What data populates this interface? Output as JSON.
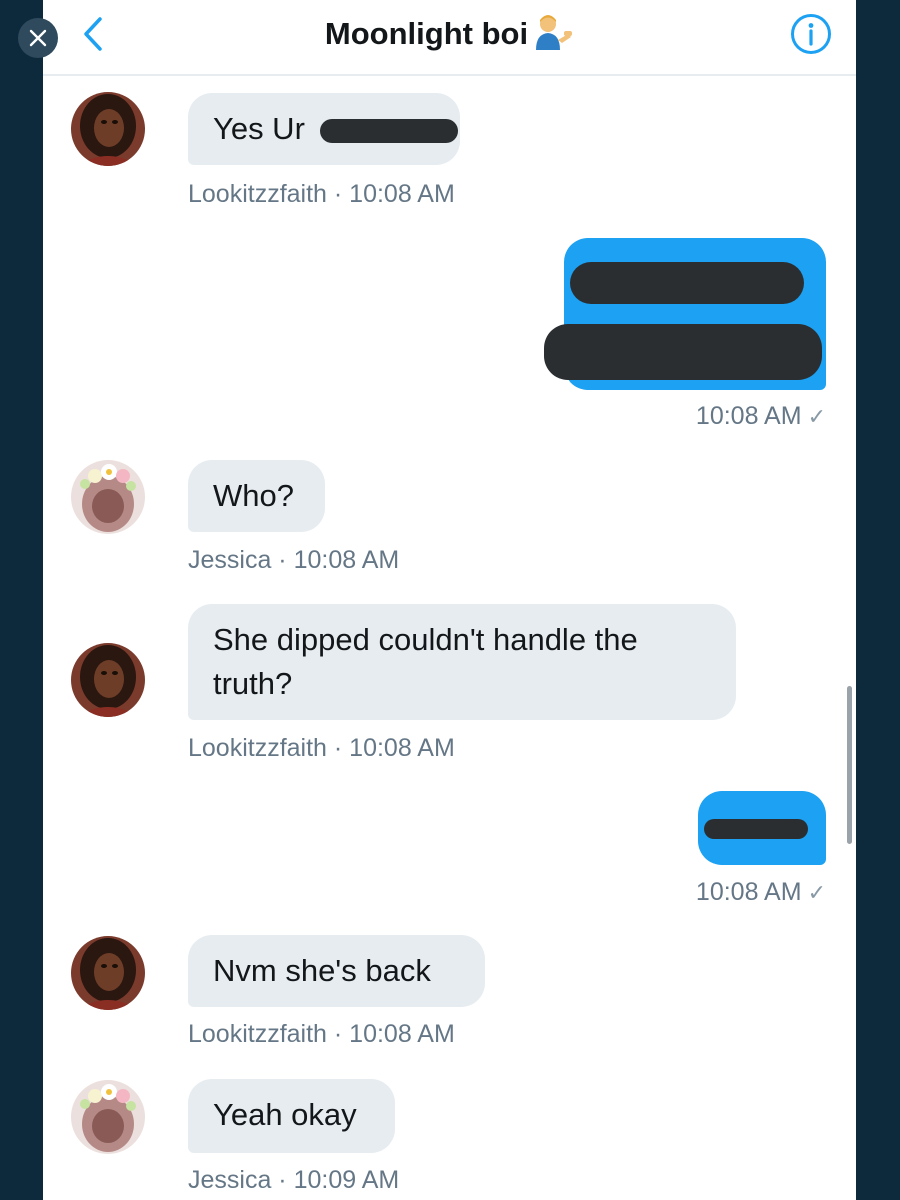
{
  "app": {
    "close_icon": "close-icon",
    "accent_color": "#1da1f2"
  },
  "header": {
    "back_icon": "chevron-left-icon",
    "title": "Moonlight boi",
    "title_emoji": "man-tipping-hand-emoji",
    "info_icon": "info-icon"
  },
  "messages": [
    {
      "direction": "in",
      "sender": "Lookitzzfaith",
      "text": "Yes Ur",
      "redacted": true,
      "time": "10:08 AM",
      "meta": "Lookitzzfaith · 10:08 AM"
    },
    {
      "direction": "out",
      "text": "",
      "redacted": true,
      "time": "10:08 AM",
      "status_icon": "check-icon"
    },
    {
      "direction": "in",
      "sender": "Jessica",
      "text": "Who?",
      "time": "10:08 AM",
      "meta": "Jessica · 10:08 AM"
    },
    {
      "direction": "in",
      "sender": "Lookitzzfaith",
      "text": "She dipped couldn't handle the truth?",
      "time": "10:08 AM",
      "meta": "Lookitzzfaith · 10:08 AM"
    },
    {
      "direction": "out",
      "text": "",
      "redacted": true,
      "time": "10:08 AM",
      "status_icon": "check-icon"
    },
    {
      "direction": "in",
      "sender": "Lookitzzfaith",
      "text": "Nvm she's back",
      "time": "10:08 AM",
      "meta": "Lookitzzfaith · 10:08 AM"
    },
    {
      "direction": "in",
      "sender": "Jessica",
      "text": "Yeah okay",
      "time": "10:09 AM",
      "meta": "Jessica · 10:09 AM"
    }
  ]
}
